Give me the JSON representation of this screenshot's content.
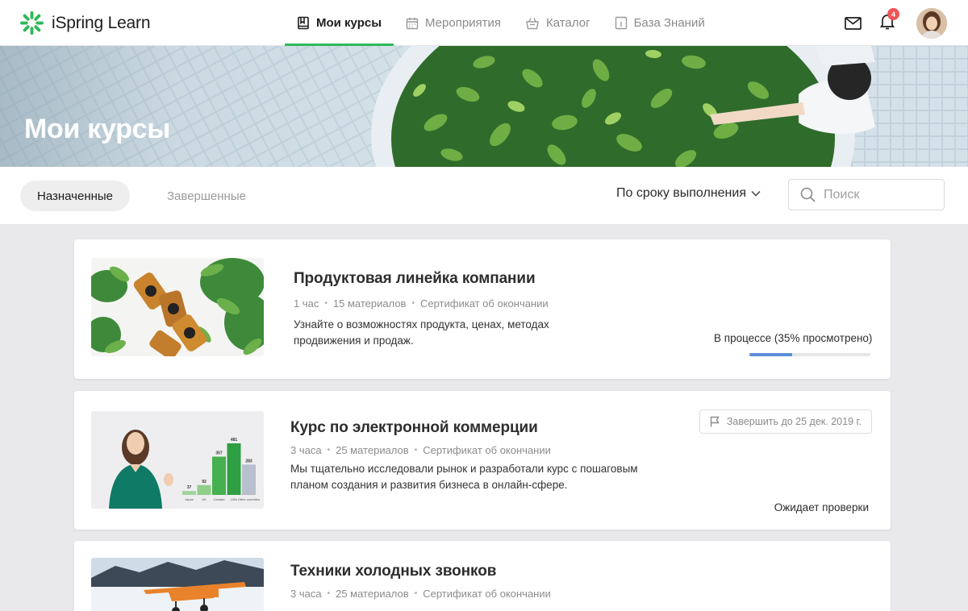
{
  "app": {
    "name": "iSpring Learn"
  },
  "nav": {
    "items": [
      {
        "label": "Мои курсы",
        "icon": "book-icon",
        "active": true
      },
      {
        "label": "Мероприятия",
        "icon": "calendar-icon",
        "active": false
      },
      {
        "label": "Каталог",
        "icon": "basket-icon",
        "active": false
      },
      {
        "label": "База Знаний",
        "icon": "info-icon",
        "active": false
      }
    ]
  },
  "header": {
    "notifications_count": "4"
  },
  "banner": {
    "title": "Мои курсы"
  },
  "filters": {
    "tabs": [
      {
        "label": "Назначенные",
        "active": true
      },
      {
        "label": "Завершенные",
        "active": false
      }
    ],
    "sort_label": "По сроку выполнения",
    "search_placeholder": "Поиск"
  },
  "courses": [
    {
      "title": "Продуктовая линейка компании",
      "meta": [
        "1 час",
        "15 материалов",
        "Сертификат об окончании"
      ],
      "description": "Узнайте о возможностях продукта, ценах, методах продвижения и продаж.",
      "status": "В процессе (35% просмотрено)",
      "progress": 0.35
    },
    {
      "title": "Курс по электронной коммерции",
      "meta": [
        "3 часа",
        "25 материалов",
        "Сертификат об окончании"
      ],
      "description": "Мы тщательно исследовали рынок и разработали курс с пошаговым планом создания и развития бизнеса в онлайн-сфере.",
      "deadline": "Завершить до 25 дек. 2019 г.",
      "status": "Ожидает проверки",
      "thumb_chart": {
        "categories": [
          "Japan",
          "UK",
          "Canada",
          "USA",
          "Other countries"
        ],
        "values": [
          37,
          92,
          357,
          481,
          283
        ]
      }
    },
    {
      "title": "Техники холодных звонков",
      "meta": [
        "3 часа",
        "25 материалов",
        "Сертификат об окончании"
      ]
    }
  ],
  "colors": {
    "accent": "#2fb85a",
    "progress": "#5b8ed9",
    "badge": "#f05454"
  }
}
